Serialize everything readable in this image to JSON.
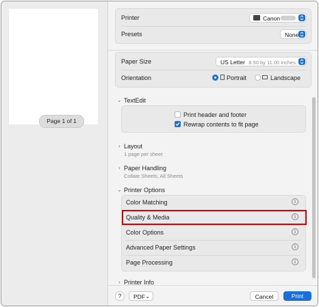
{
  "preview": {
    "page_label": "Page 1 of 1"
  },
  "printer": {
    "label": "Printer",
    "value": "Canon"
  },
  "presets": {
    "label": "Presets",
    "value": "None"
  },
  "paper_size": {
    "label": "Paper Size",
    "value": "US Letter",
    "hint": "8.50 by 11.00 inches"
  },
  "orientation": {
    "label": "Orientation",
    "portrait": "Portrait",
    "landscape": "Landscape"
  },
  "textedit": {
    "title": "TextEdit",
    "print_header": "Print header and footer",
    "rewrap": "Rewrap contents to fit page"
  },
  "layout": {
    "title": "Layout",
    "sub": "1 page per sheet"
  },
  "paper_handling": {
    "title": "Paper Handling",
    "sub": "Collate Sheets, All Sheets"
  },
  "printer_options": {
    "title": "Printer Options",
    "items": [
      "Color Matching",
      "Quality & Media",
      "Color Options",
      "Advanced Paper Settings",
      "Page Processing"
    ]
  },
  "printer_info": {
    "title": "Printer Info"
  },
  "bottom": {
    "help": "?",
    "pdf": "PDF",
    "cancel": "Cancel",
    "print": "Print"
  },
  "colors": {
    "accent": "#1a6fd9",
    "highlight": "#d40000"
  }
}
